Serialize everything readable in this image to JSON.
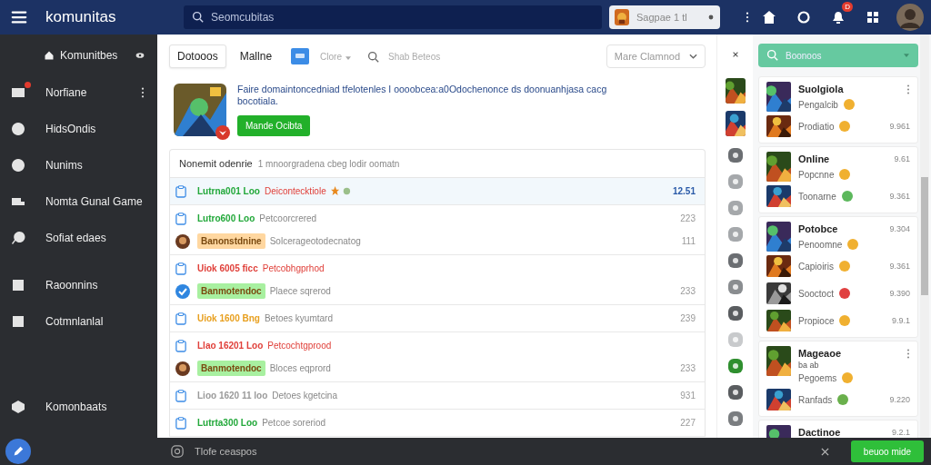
{
  "topbar": {
    "brand": "komunitas",
    "search": {
      "placeholder": "Seomcubitas"
    },
    "game_select": {
      "label": "Sagpae 1 tl"
    },
    "notification_badge": "D"
  },
  "sidebar": {
    "items": [
      {
        "label": "Komunitbes",
        "kind": "section"
      },
      {
        "label": "Norfiane",
        "kind": "link",
        "badge": true,
        "menu": true
      },
      {
        "label": "HidsOndis",
        "kind": "link",
        "badge": false,
        "menu": false
      },
      {
        "label": "Nunims",
        "kind": "link",
        "badge": false,
        "menu": false
      },
      {
        "label": "Nomta Gunal Game",
        "kind": "link",
        "badge": false,
        "menu": false
      },
      {
        "label": "Sofiat edaes",
        "kind": "link",
        "badge": false,
        "menu": false
      },
      {
        "label": "Raoonnins",
        "kind": "link",
        "badge": false,
        "menu": false,
        "gap": true
      },
      {
        "label": "Cotmnlanlal",
        "kind": "link",
        "badge": false,
        "menu": false
      },
      {
        "label": "Komonbaats",
        "kind": "link",
        "badge": false,
        "menu": false,
        "bottom": true
      }
    ]
  },
  "toolbar": {
    "tabs": [
      {
        "label": "Dotooos",
        "selected": true
      },
      {
        "label": "Mallne",
        "selected": false
      }
    ],
    "filter": "Clore",
    "search": {
      "placeholder": "Shab Beteos"
    },
    "sort": "Mare Clamnod"
  },
  "promo": {
    "text": "Faire domaintoncedniad tfelotenles I oooobcea:a0Odochenonce ds doonuanhjasa cacg bocotiala.",
    "button": "Mande Ocibta"
  },
  "feed": {
    "title": "Nonemit odenrie",
    "subtitle": "1 mnoorgradena cbeg lodir oomatn",
    "rows": [
      {
        "code": "Lutrna001 Loo",
        "color": "#22a83a",
        "text": "Deicontecktiole",
        "urgent": true,
        "starred": true,
        "time": "12.51",
        "selected": true
      },
      {
        "code": "Lutro600 Loo",
        "color": "#22a83a",
        "text": "Petcoorcrered",
        "urgent": false,
        "starred": false,
        "time": "223",
        "selected": false,
        "sub": {
          "kind": "picture",
          "tag": "Banonstdnine",
          "color": "#ffd7a0",
          "text": "Solcerageotodecnatog",
          "time": "111"
        }
      },
      {
        "code": "Uiok 6005 ficc",
        "color": "#e0403a",
        "text": "Petcobhgprhod",
        "urgent": true,
        "starred": false,
        "time": "",
        "selected": false,
        "sub": {
          "kind": "check",
          "tag": "Banmotendoc",
          "color": "#a8f0a0",
          "text": "Plaece sqrerod",
          "time": "233"
        }
      },
      {
        "code": "Uiok 1600 Bng",
        "color": "#e8a020",
        "text": "Betoes kyumtard",
        "urgent": false,
        "starred": false,
        "time": "239",
        "selected": false
      },
      {
        "code": "Llao 16201 Loo",
        "color": "#e0403a",
        "text": "Petcochtgprood",
        "urgent": true,
        "starred": false,
        "time": "",
        "selected": false,
        "sub": {
          "kind": "picture",
          "tag": "Banmotendoc",
          "color": "#a8f0a0",
          "text": "Bloces eqprord",
          "time": "233"
        }
      },
      {
        "code": "Lioo 1620 11 loo",
        "color": "#9a9a9a",
        "text": "Detoes kgetcina",
        "urgent": false,
        "starred": false,
        "time": "931",
        "selected": false
      },
      {
        "code": "Lutrta300 Loo",
        "color": "#22a83a",
        "text": "Petcoe soreriod",
        "urgent": false,
        "starred": false,
        "time": "227",
        "selected": false
      }
    ]
  },
  "rail": [
    {
      "kind": "picture"
    },
    {
      "kind": "picture"
    },
    {
      "kind": "round",
      "color": "#6b6e72"
    },
    {
      "kind": "round",
      "color": "#a5a8ab"
    },
    {
      "kind": "round",
      "color": "#a5a8ab"
    },
    {
      "kind": "round",
      "color": "#a5a8ab"
    },
    {
      "kind": "round",
      "color": "#6b6e72"
    },
    {
      "kind": "round",
      "color": "#8a8d90"
    },
    {
      "kind": "round",
      "color": "#5a5d60"
    },
    {
      "kind": "round",
      "color": "#c8cacc"
    },
    {
      "kind": "round",
      "color": "#2f8f2f"
    },
    {
      "kind": "round",
      "color": "#5a5d60"
    },
    {
      "kind": "round",
      "color": "#7a7d80"
    }
  ],
  "panel": {
    "search": {
      "placeholder": "Boonoos"
    },
    "groups": [
      {
        "title": "Suolgiola",
        "menu": true,
        "lead": {
          "label": "Pengalcib",
          "color": "#f0b030"
        },
        "items": [
          {
            "label": "Prodiatio",
            "color": "#f0b030",
            "value": "9.961"
          }
        ]
      },
      {
        "title": "Online",
        "value": "9.61",
        "menu": false,
        "lead": {
          "label": "Popcnne",
          "color": "#f0b030"
        },
        "items": [
          {
            "label": "Toonarne",
            "color": "#5cb85c",
            "value": "9.361"
          }
        ]
      },
      {
        "title": "Potobce",
        "value": "9.304",
        "menu": false,
        "lead": {
          "label": "Penoomne",
          "color": "#f0b030"
        },
        "items": [
          {
            "label": "Capioiris",
            "color": "#f0b030",
            "value": "9.361"
          },
          {
            "label": "Sooctoct",
            "color": "#e04040",
            "value": "9.390"
          },
          {
            "label": "Propioce",
            "color": "#f0b030",
            "value": "9.9.1"
          }
        ]
      },
      {
        "title": "Mageaoe",
        "subtitle": "ba ab",
        "menu": true,
        "lead": {
          "label": "Pegoems",
          "color": "#f0b030"
        },
        "items": [
          {
            "label": "Ranfads",
            "color": "#6ab04c",
            "value": "9.220"
          }
        ]
      },
      {
        "title": "Dactinoe",
        "value": "9.2.1",
        "menu": false
      }
    ]
  },
  "bottombar": {
    "status": "Tlofe ceaspos",
    "button": "beuoo mide"
  }
}
